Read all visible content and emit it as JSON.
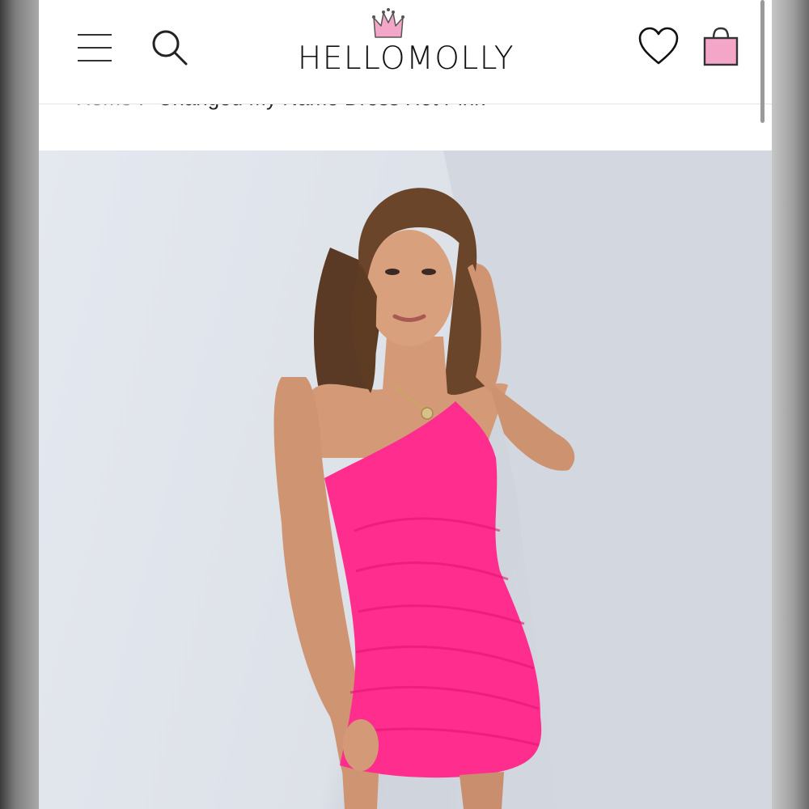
{
  "brand": {
    "name": "HELLOMOLLY",
    "accent": "#f4a6c8"
  },
  "header": {
    "menu_icon": "hamburger-menu-icon",
    "search_icon": "search-icon",
    "wishlist_icon": "heart-icon",
    "bag_icon": "shopping-bag-icon"
  },
  "breadcrumb": {
    "home": "Home",
    "separator": "/",
    "current": "Changed My Name Dress Hot Pink"
  },
  "product": {
    "image_alt": "Model wearing one-shoulder ruched mini dress in hot pink",
    "dress_color": "#ff2d8e"
  }
}
